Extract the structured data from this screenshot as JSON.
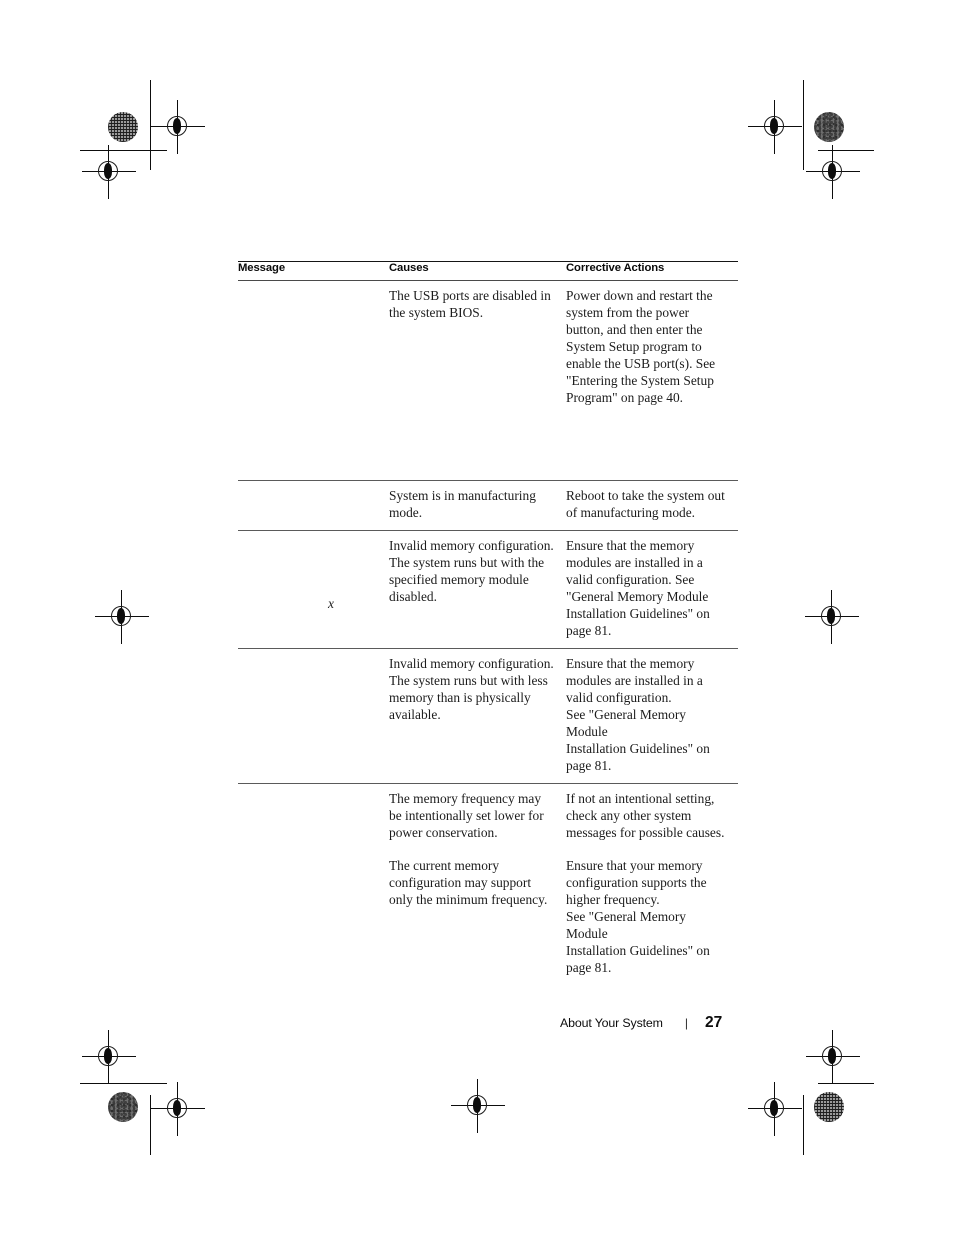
{
  "page": {
    "footer_label": "About Your System",
    "footer_separator": "|",
    "page_number": "27"
  },
  "table": {
    "headers": {
      "message": "Message",
      "causes": "Causes",
      "corrective": "Corrective Actions"
    },
    "rows": [
      {
        "message": "",
        "message_variable": "",
        "causes": [
          "The USB ports are disabled in the system BIOS."
        ],
        "corrective": [
          "Power down and restart the system from the power button, and then enter the System Setup program to enable the USB port(s). See \"Entering the System Setup Program\" on page 40."
        ]
      },
      {
        "message": "",
        "message_variable": "",
        "causes": [
          "System is in manufacturing mode."
        ],
        "corrective": [
          "Reboot to take the system out of manufacturing mode."
        ]
      },
      {
        "message": "",
        "message_variable": "x",
        "causes": [
          "Invalid memory configuration. The system runs but with the specified memory module disabled."
        ],
        "corrective": [
          "Ensure that the memory modules are installed in a valid configuration. See \"General Memory Module Installation Guidelines\" on page 81."
        ]
      },
      {
        "message": "",
        "message_variable": "",
        "causes": [
          "Invalid memory configuration. The system runs but with less memory than is physically available."
        ],
        "corrective": [
          "Ensure that the memory modules are installed in a valid configuration.\nSee \"General Memory\nModule\nInstallation Guidelines\" on page 81."
        ]
      },
      {
        "message": "",
        "message_variable": "",
        "causes": [
          "The memory frequency may be intentionally set lower for power conservation.",
          "The current memory configuration may support only the minimum frequency."
        ],
        "corrective": [
          "If not an intentional setting, check any other system messages for possible causes.",
          "Ensure that your memory configuration supports the higher frequency.\nSee \"General Memory\nModule\nInstallation Guidelines\" on page 81."
        ]
      }
    ]
  },
  "print_marks": {
    "registration_target_name": "registration-target",
    "halftone_patch_name": "halftone-density-patch",
    "crop_rule_name": "crop-rule"
  }
}
